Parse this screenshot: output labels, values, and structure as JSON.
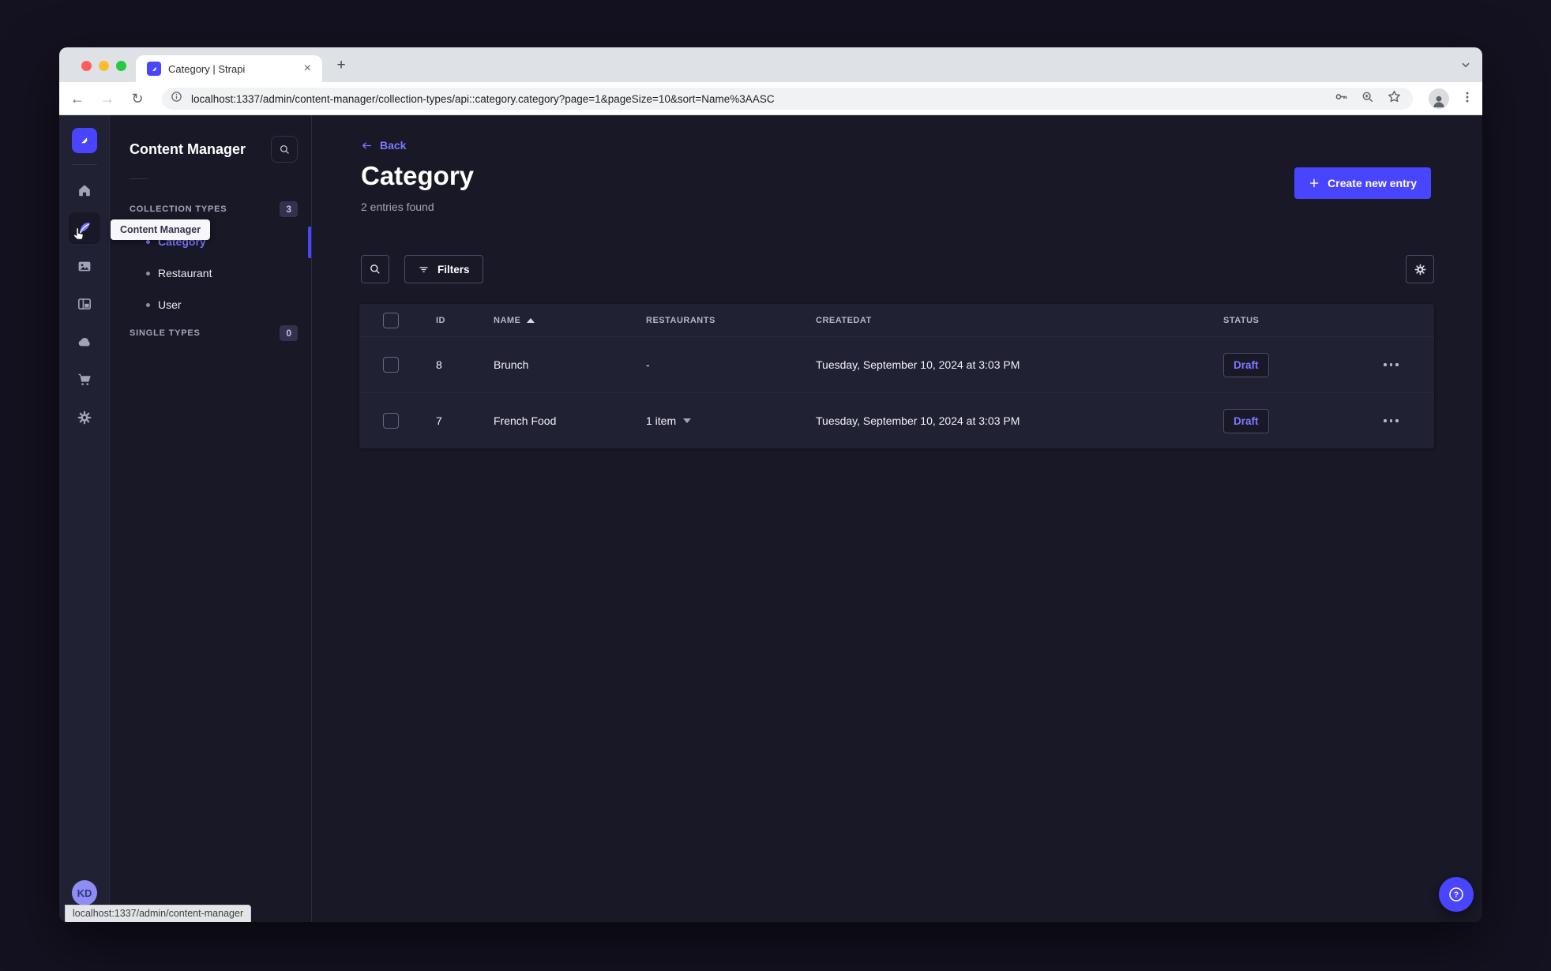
{
  "browser": {
    "tab_title": "Category | Strapi",
    "url": "localhost:1337/admin/content-manager/collection-types/api::category.category?page=1&pageSize=10&sort=Name%3AASC",
    "status_tooltip": "localhost:1337/admin/content-manager"
  },
  "sidebar": {
    "icons": [
      "strapi-logo",
      "home",
      "content-manager",
      "media-library",
      "content-type-builder",
      "cloud",
      "marketplace",
      "settings"
    ],
    "tooltip": "Content Manager",
    "avatar_initials": "KD"
  },
  "subnav": {
    "title": "Content Manager",
    "sections": [
      {
        "label": "COLLECTION TYPES",
        "badge": "3",
        "items": [
          {
            "label": "Category"
          },
          {
            "label": "Restaurant"
          },
          {
            "label": "User"
          }
        ]
      },
      {
        "label": "SINGLE TYPES",
        "badge": "0",
        "items": []
      }
    ]
  },
  "main": {
    "back_label": "Back",
    "title": "Category",
    "subtitle": "2 entries found",
    "create_button": "Create new entry",
    "filters_button": "Filters",
    "table": {
      "headers": {
        "id": "ID",
        "name": "NAME",
        "restaurants": "RESTAURANTS",
        "createdat": "CREATEDAT",
        "status": "STATUS"
      },
      "rows": [
        {
          "id": "8",
          "name": "Brunch",
          "restaurants": "-",
          "createdat": "Tuesday, September 10, 2024 at 3:03 PM",
          "status": "Draft"
        },
        {
          "id": "7",
          "name": "French Food",
          "restaurants": "1 item",
          "createdat": "Tuesday, September 10, 2024 at 3:03 PM",
          "status": "Draft"
        }
      ]
    }
  },
  "colors": {
    "primary": "#4945ff",
    "primary_light": "#7b79ff",
    "page_bg": "#181826",
    "card_bg": "#212134"
  }
}
